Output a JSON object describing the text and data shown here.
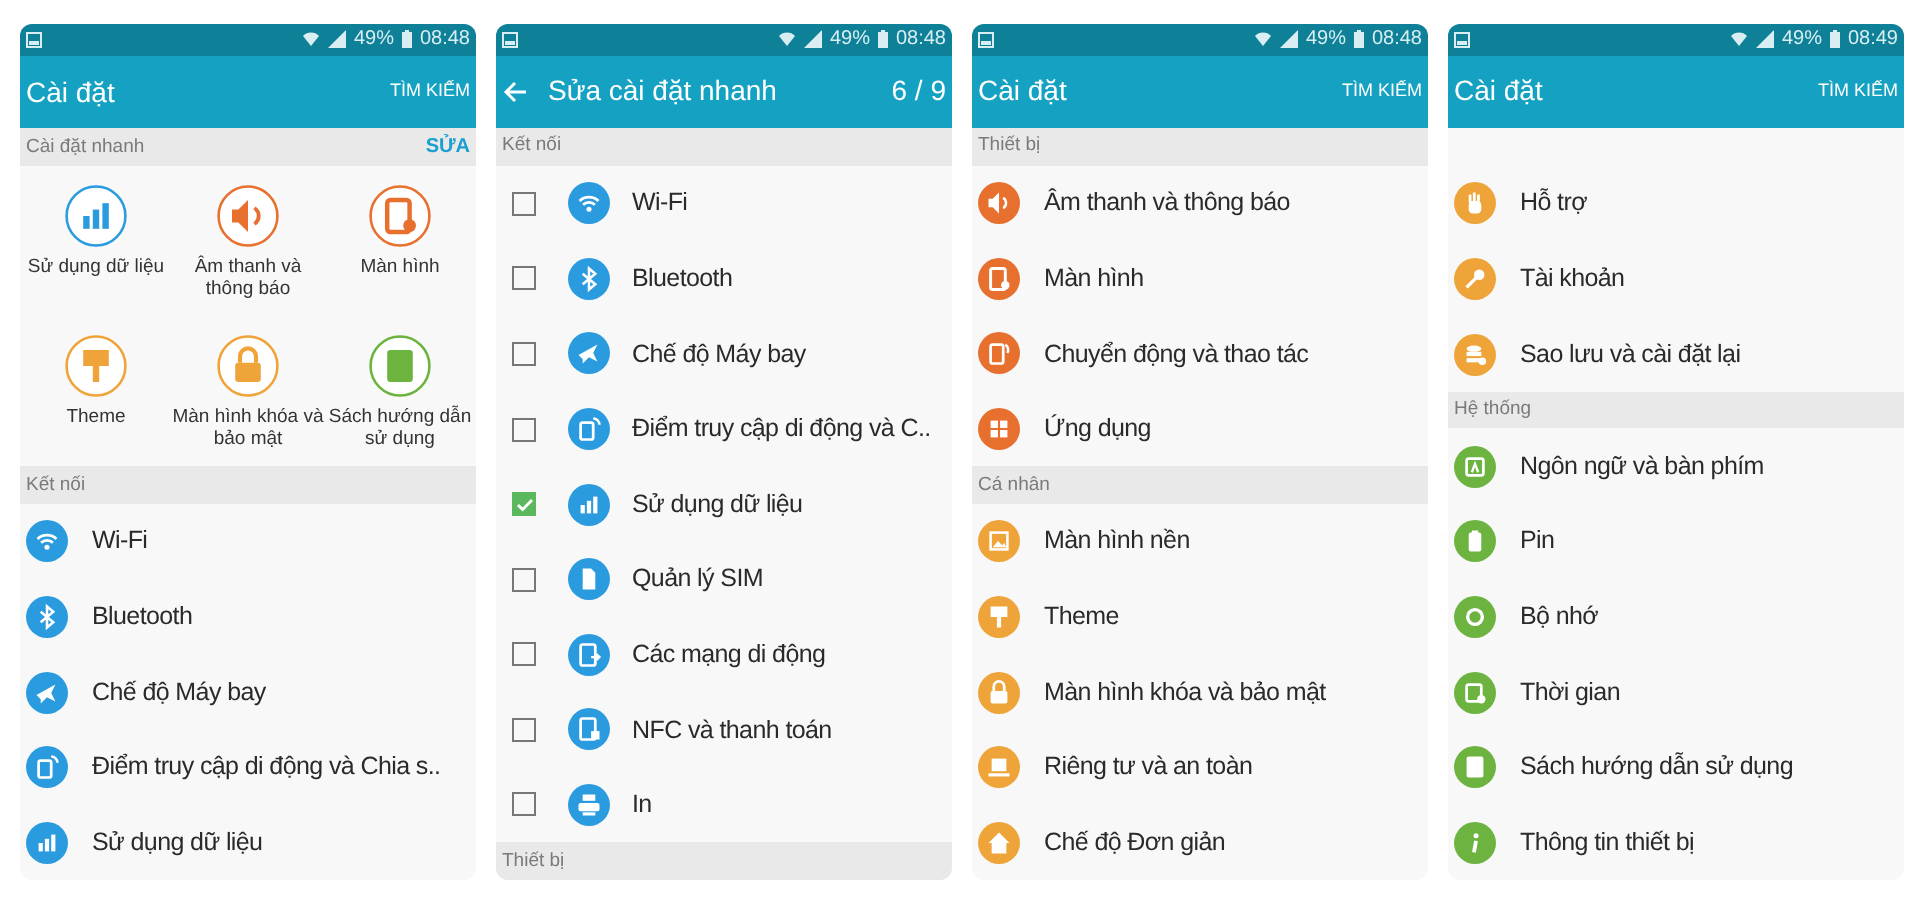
{
  "screens": [
    {
      "status_bar": {
        "battery": "49%",
        "time": "08:48"
      },
      "app_bar": {
        "kind": "main",
        "title": "Cài đặt",
        "action": "TÌM KIẾM"
      },
      "sections": [
        {
          "label": "Cài đặt nhanh",
          "action": "SỬA",
          "kind": "grid",
          "items": [
            {
              "label": "Sử dụng dữ liệu",
              "color": "#2b9be0"
            },
            {
              "label": "Âm thanh và thông báo",
              "color": "#e8702f"
            },
            {
              "label": "Màn hình",
              "color": "#e8702f"
            },
            {
              "label": "Theme",
              "color": "#efa43a"
            },
            {
              "label": "Màn hình khóa và bảo mật",
              "color": "#efa43a"
            },
            {
              "label": "Sách hướng dẫn sử dụng",
              "color": "#6cb33f"
            }
          ]
        },
        {
          "label": "Kết nối",
          "kind": "list",
          "items": [
            {
              "label": "Wi-Fi",
              "color": "#2b9be0"
            },
            {
              "label": "Bluetooth",
              "color": "#2b9be0"
            },
            {
              "label": "Chế độ Máy bay",
              "color": "#2b9be0"
            },
            {
              "label": "Điểm truy cập di động và Chia s..",
              "color": "#2b9be0"
            },
            {
              "label": "Sử dụng dữ liệu",
              "color": "#2b9be0"
            }
          ]
        }
      ]
    },
    {
      "status_bar": {
        "battery": "49%",
        "time": "08:48"
      },
      "app_bar": {
        "kind": "edit",
        "title": "Sửa cài đặt nhanh",
        "counter": "6 / 9"
      },
      "sections": [
        {
          "label": "Kết nối",
          "kind": "checklist",
          "items": [
            {
              "label": "Wi-Fi",
              "color": "#2b9be0",
              "checked": false
            },
            {
              "label": "Bluetooth",
              "color": "#2b9be0",
              "checked": false
            },
            {
              "label": "Chế độ Máy bay",
              "color": "#2b9be0",
              "checked": false
            },
            {
              "label": "Điểm truy cập di động và C..",
              "color": "#2b9be0",
              "checked": false
            },
            {
              "label": "Sử dụng dữ liệu",
              "color": "#2b9be0",
              "checked": true
            },
            {
              "label": "Quản lý SIM",
              "color": "#2b9be0",
              "checked": false
            },
            {
              "label": "Các mạng di động",
              "color": "#2b9be0",
              "checked": false
            },
            {
              "label": "NFC và thanh toán",
              "color": "#2b9be0",
              "checked": false
            },
            {
              "label": "In",
              "color": "#2b9be0",
              "checked": false
            }
          ]
        },
        {
          "label": "Thiết bị",
          "kind": "list"
        }
      ]
    },
    {
      "status_bar": {
        "battery": "49%",
        "time": "08:48"
      },
      "app_bar": {
        "kind": "main",
        "title": "Cài đặt",
        "action": "TÌM KIẾM"
      },
      "sections": [
        {
          "label": "Thiết bị",
          "kind": "list",
          "items": [
            {
              "label": "Âm thanh và thông báo",
              "color": "#e8702f"
            },
            {
              "label": "Màn hình",
              "color": "#e8702f"
            },
            {
              "label": "Chuyển động và thao tác",
              "color": "#e8702f"
            },
            {
              "label": "Ứng dụng",
              "color": "#e8702f"
            }
          ]
        },
        {
          "label": "Cá nhân",
          "kind": "list",
          "items": [
            {
              "label": "Màn hình nền",
              "color": "#efa43a"
            },
            {
              "label": "Theme",
              "color": "#efa43a"
            },
            {
              "label": "Màn hình khóa và bảo mật",
              "color": "#efa43a"
            },
            {
              "label": "Riêng tư và an toàn",
              "color": "#efa43a"
            },
            {
              "label": "Chế độ Đơn giản",
              "color": "#efa43a"
            }
          ]
        }
      ]
    },
    {
      "status_bar": {
        "battery": "49%",
        "time": "08:49"
      },
      "app_bar": {
        "kind": "main",
        "title": "Cài đặt",
        "action": "TÌM KIẾM"
      },
      "sections": [
        {
          "kind": "list",
          "items": [
            {
              "label": "Hỗ trợ",
              "color": "#efa43a"
            },
            {
              "label": "Tài khoản",
              "color": "#efa43a"
            },
            {
              "label": "Sao lưu và cài đặt lại",
              "color": "#efa43a"
            }
          ]
        },
        {
          "label": "Hệ thống",
          "kind": "list",
          "items": [
            {
              "label": "Ngôn ngữ và bàn phím",
              "color": "#6cb33f"
            },
            {
              "label": "Pin",
              "color": "#6cb33f"
            },
            {
              "label": "Bộ nhớ",
              "color": "#6cb33f"
            },
            {
              "label": "Thời gian",
              "color": "#6cb33f"
            },
            {
              "label": "Sách hướng dẫn sử dụng",
              "color": "#6cb33f"
            },
            {
              "label": "Thông tin thiết bị",
              "color": "#6cb33f"
            }
          ]
        }
      ]
    }
  ]
}
